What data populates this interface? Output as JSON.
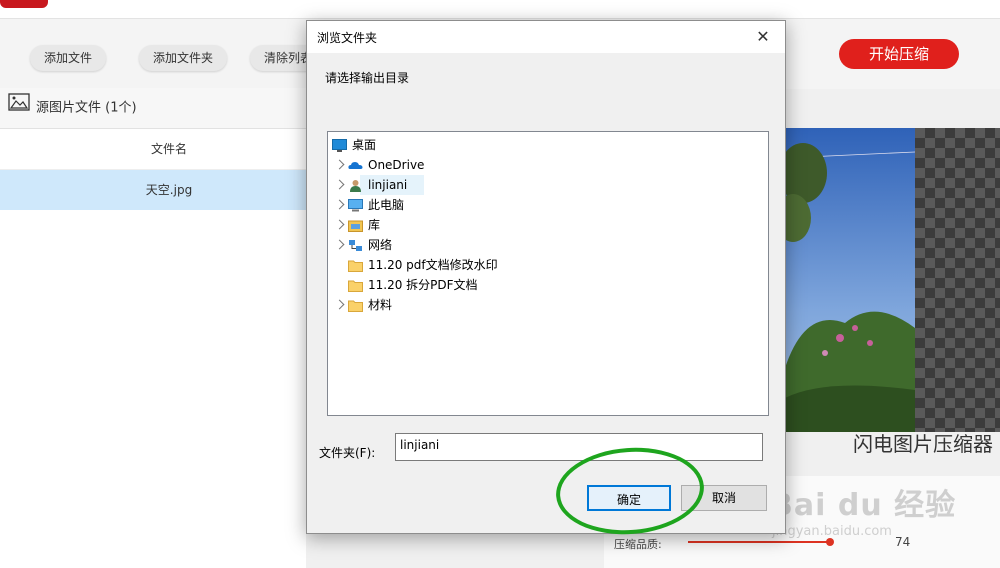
{
  "toolbar": {
    "add_file": "添加文件",
    "add_folder": "添加文件夹",
    "clear_list": "清除列表",
    "start": "开始压缩"
  },
  "left_panel": {
    "header": "源图片文件 (1个)",
    "column": "文件名",
    "files": [
      "天空.jpg"
    ]
  },
  "right_panel": {
    "watermark": "闪电图片压缩器",
    "quality_label": "压缩品质:",
    "quality_value": "74",
    "quality": 0.74,
    "baidu_logo": "Bai du 经验",
    "baidu_url": "jingyan.baidu.com"
  },
  "dialog": {
    "title": "浏览文件夹",
    "close": "✕",
    "prompt": "请选择输出目录",
    "tree": [
      {
        "label": "桌面",
        "icon": "desktop-icon",
        "expandable": false,
        "indent": 0
      },
      {
        "label": "OneDrive",
        "icon": "onedrive-icon",
        "expandable": true,
        "indent": 1
      },
      {
        "label": "linjiani",
        "icon": "user-icon",
        "expandable": true,
        "indent": 1,
        "selected": true
      },
      {
        "label": "此电脑",
        "icon": "computer-icon",
        "expandable": true,
        "indent": 1
      },
      {
        "label": "库",
        "icon": "library-icon",
        "expandable": true,
        "indent": 1
      },
      {
        "label": "网络",
        "icon": "network-icon",
        "expandable": true,
        "indent": 1
      },
      {
        "label": "11.20 pdf文档修改水印",
        "icon": "folder-icon",
        "expandable": false,
        "indent": 1
      },
      {
        "label": "11.20 拆分PDF文档",
        "icon": "folder-icon",
        "expandable": false,
        "indent": 1
      },
      {
        "label": "材料",
        "icon": "folder-icon",
        "expandable": true,
        "indent": 1
      }
    ],
    "folder_label": "文件夹(F):",
    "folder_value": "linjiani",
    "ok": "确定",
    "cancel": "取消"
  },
  "colors": {
    "accent_red": "#e0201c",
    "selection_blue": "#cfe8fb",
    "dialog_focus": "#0078d7",
    "annotation_green": "#1ea51e"
  }
}
